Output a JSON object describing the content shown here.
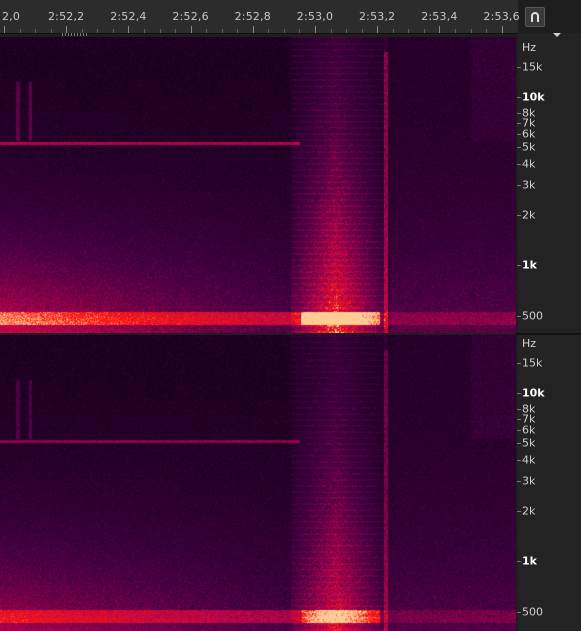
{
  "timeline": {
    "ticks": [
      {
        "label": "2,0"
      },
      {
        "label": "2:52,2"
      },
      {
        "label": "2:52,4"
      },
      {
        "label": "2:52,6"
      },
      {
        "label": "2:52,8"
      },
      {
        "label": "2:53,0"
      },
      {
        "label": "2:53,2"
      },
      {
        "label": "2:53,4"
      },
      {
        "label": "2:53,6"
      }
    ],
    "snap_button_icon": "magnet-icon",
    "panel_menu_icon": "chevron-down-icon"
  },
  "ruler": {
    "unit": "Hz",
    "labels": [
      {
        "text": "15k",
        "hz": 15000,
        "bold": false
      },
      {
        "text": "10k",
        "hz": 10000,
        "bold": true
      },
      {
        "text": "8k",
        "hz": 8000,
        "bold": false
      },
      {
        "text": "7k",
        "hz": 7000,
        "bold": false
      },
      {
        "text": "6k",
        "hz": 6000,
        "bold": false
      },
      {
        "text": "5k",
        "hz": 5000,
        "bold": false
      },
      {
        "text": "4k",
        "hz": 4000,
        "bold": false
      },
      {
        "text": "3k",
        "hz": 3000,
        "bold": false
      },
      {
        "text": "2k",
        "hz": 2000,
        "bold": false
      },
      {
        "text": "1k",
        "hz": 1000,
        "bold": true
      },
      {
        "text": "500",
        "hz": 500,
        "bold": false
      }
    ]
  },
  "colors": {
    "spectrum_low": "#0d0014",
    "spectrum_mid": "#6a0a5a",
    "spectrum_high": "#ff2020",
    "spectrum_peak": "#ffd0a0"
  }
}
